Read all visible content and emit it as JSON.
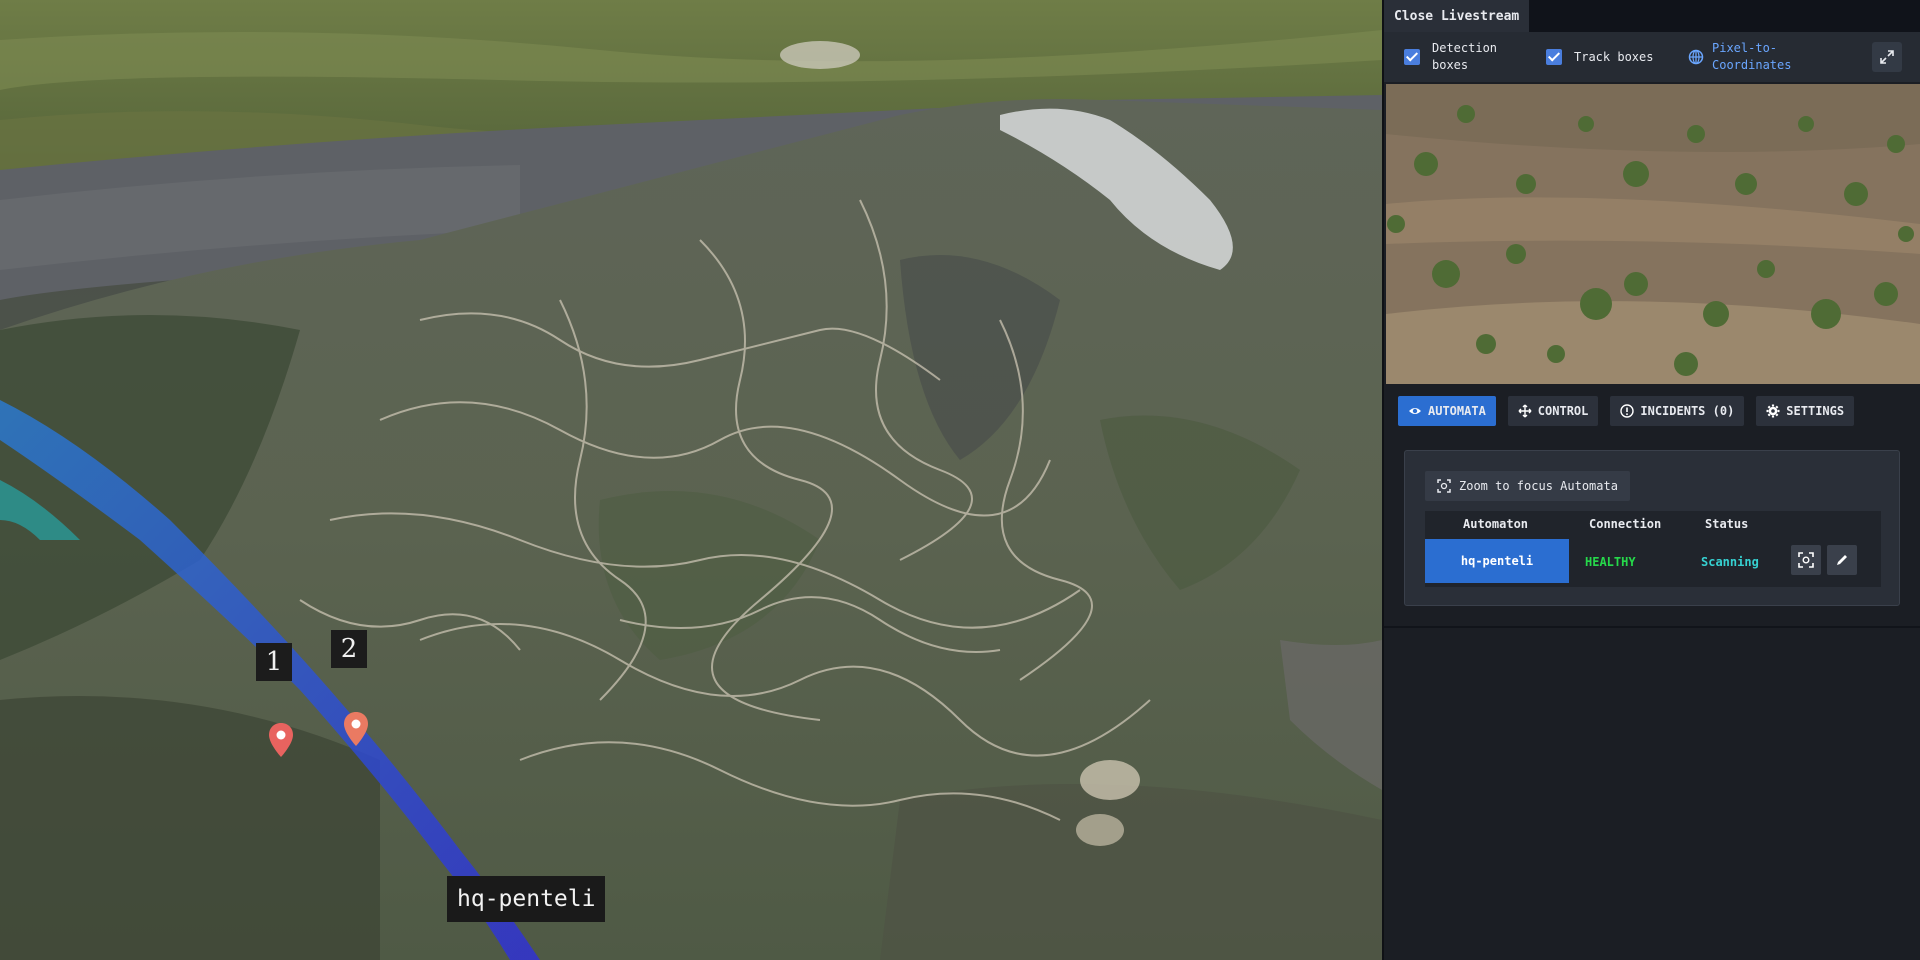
{
  "map": {
    "markers": [
      {
        "label": "1",
        "pin_color": "#e8635f"
      },
      {
        "label": "2",
        "pin_color": "#ea7a62"
      }
    ],
    "automaton_label": "hq-penteli",
    "path_color": "#2f56d8"
  },
  "livestream": {
    "close_tab": "Close Livestream",
    "detection_boxes": {
      "label": "Detection boxes",
      "checked": true
    },
    "track_boxes": {
      "label": "Track boxes",
      "checked": true
    },
    "pixel_to_coordinates": "Pixel-to-Coordinates",
    "expand_icon": "expand-icon"
  },
  "tabs": [
    {
      "label": "AUTOMATA",
      "icon": "eye-icon",
      "active": true
    },
    {
      "label": "CONTROL",
      "icon": "move-icon",
      "active": false
    },
    {
      "label": "INCIDENTS (0)",
      "icon": "alert-icon",
      "active": false
    },
    {
      "label": "SETTINGS",
      "icon": "gear-icon",
      "active": false
    }
  ],
  "automata": {
    "zoom_button": "Zoom to focus Automata",
    "columns": [
      "Automaton",
      "Connection",
      "Status"
    ],
    "rows": [
      {
        "name": "hq-penteli",
        "connection": "HEALTHY",
        "status": "Scanning"
      }
    ]
  },
  "colors": {
    "accent": "#2b6ed1",
    "healthy": "#26d94b",
    "scanning": "#36d1d1",
    "link": "#6aa6ff"
  }
}
